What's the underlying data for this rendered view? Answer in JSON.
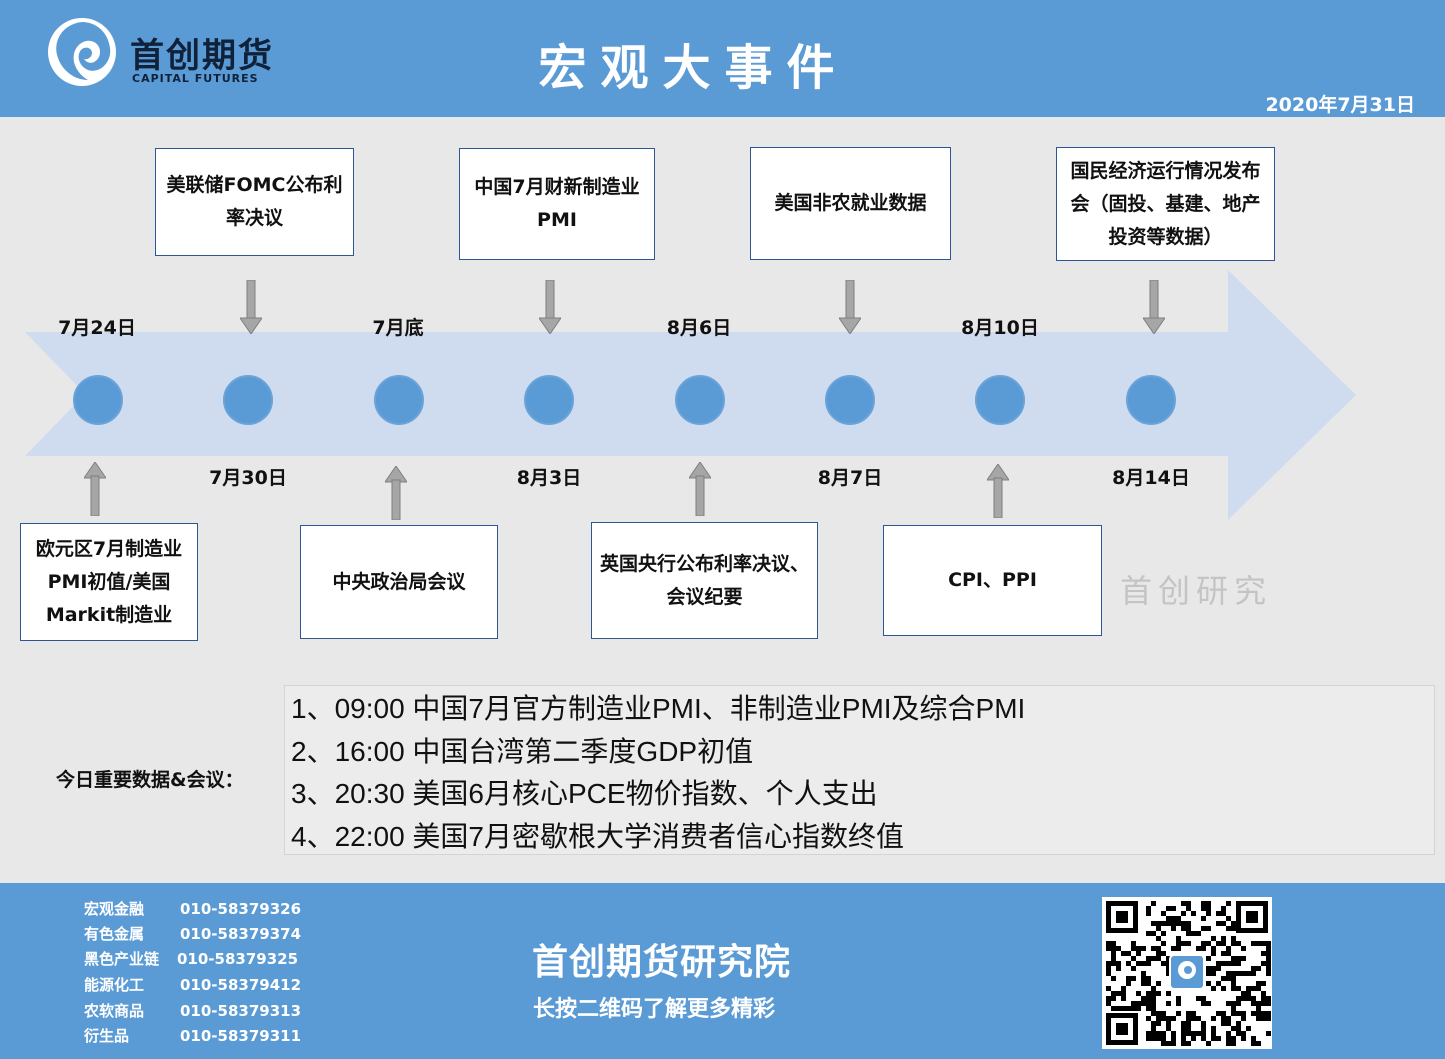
{
  "header": {
    "logo_cn": "首创期货",
    "logo_en": "CAPITAL FUTURES",
    "title": "宏观大事件",
    "date": "2020年7月31日"
  },
  "timeline": {
    "dates": {
      "d1": "7月24日",
      "d2": "7月30日",
      "d3": "7月底",
      "d4": "8月3日",
      "d5": "8月6日",
      "d6": "8月7日",
      "d7": "8月10日",
      "d8": "8月14日"
    },
    "events": {
      "e1": "欧元区7月制造业PMI初值/美国Markit制造业",
      "e2": "美联储FOMC公布利率决议",
      "e3": "中央政治局会议",
      "e4": "中国7月财新制造业PMI",
      "e5": "英国央行公布利率决议、会议纪要",
      "e6": "美国非农就业数据",
      "e7": "CPI、PPI",
      "e8": "国民经济运行情况发布会（固投、基建、地产投资等数据）"
    }
  },
  "watermark": "首创研究",
  "today": {
    "label": "今日重要数据&会议：",
    "items": [
      "1、09:00 中国7月官方制造业PMI、非制造业PMI及综合PMI",
      "2、16:00 中国台湾第二季度GDP初值",
      "3、20:30 美国6月核心PCE物价指数、个人支出",
      "4、22:00 美国7月密歇根大学消费者信心指数终值"
    ]
  },
  "footer": {
    "contacts": [
      {
        "name": "宏观金融",
        "phone": "010-58379326"
      },
      {
        "name": "有色金属",
        "phone": "010-58379374"
      },
      {
        "name": "黑色产业链",
        "phone": "010-58379325"
      },
      {
        "name": "能源化工",
        "phone": "010-58379412"
      },
      {
        "name": "农软商品",
        "phone": "010-58379313"
      },
      {
        "name": "衍生品",
        "phone": "010-58379311"
      }
    ],
    "institute": "首创期货研究院",
    "slogan": "长按二维码了解更多精彩"
  },
  "colors": {
    "brand_blue": "#5b9bd5",
    "arrow_fill": "#cfdcef",
    "box_border": "#2f5597"
  },
  "icons": [
    "logo-mark-icon",
    "qr-code-icon",
    "down-arrow-icon",
    "up-arrow-icon"
  ]
}
